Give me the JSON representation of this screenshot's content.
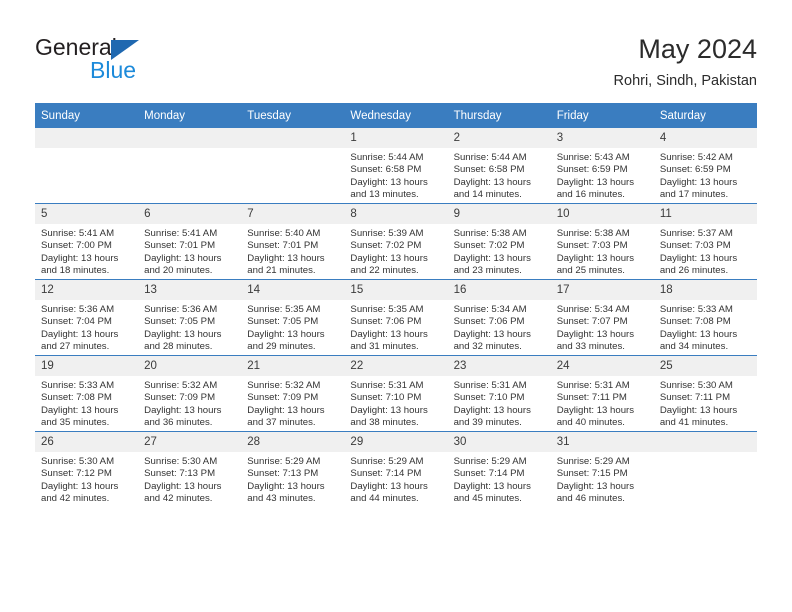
{
  "brand": {
    "name_top": "General",
    "name_bottom": "Blue",
    "accent_color": "#1c8ada",
    "triangle_color": "#1f68b0"
  },
  "header": {
    "title": "May 2024",
    "subtitle": "Rohri, Sindh, Pakistan"
  },
  "calendar": {
    "header_bg": "#3a7dc0",
    "daynum_bg": "#f0f0f0",
    "weekday_headers": [
      "Sunday",
      "Monday",
      "Tuesday",
      "Wednesday",
      "Thursday",
      "Friday",
      "Saturday"
    ],
    "weeks": [
      [
        {
          "day": "",
          "empty": true
        },
        {
          "day": "",
          "empty": true
        },
        {
          "day": "",
          "empty": true
        },
        {
          "day": "1",
          "sunrise": "Sunrise: 5:44 AM",
          "sunset": "Sunset: 6:58 PM",
          "daylight_1": "Daylight: 13 hours",
          "daylight_2": "and 13 minutes."
        },
        {
          "day": "2",
          "sunrise": "Sunrise: 5:44 AM",
          "sunset": "Sunset: 6:58 PM",
          "daylight_1": "Daylight: 13 hours",
          "daylight_2": "and 14 minutes."
        },
        {
          "day": "3",
          "sunrise": "Sunrise: 5:43 AM",
          "sunset": "Sunset: 6:59 PM",
          "daylight_1": "Daylight: 13 hours",
          "daylight_2": "and 16 minutes."
        },
        {
          "day": "4",
          "sunrise": "Sunrise: 5:42 AM",
          "sunset": "Sunset: 6:59 PM",
          "daylight_1": "Daylight: 13 hours",
          "daylight_2": "and 17 minutes."
        }
      ],
      [
        {
          "day": "5",
          "sunrise": "Sunrise: 5:41 AM",
          "sunset": "Sunset: 7:00 PM",
          "daylight_1": "Daylight: 13 hours",
          "daylight_2": "and 18 minutes."
        },
        {
          "day": "6",
          "sunrise": "Sunrise: 5:41 AM",
          "sunset": "Sunset: 7:01 PM",
          "daylight_1": "Daylight: 13 hours",
          "daylight_2": "and 20 minutes."
        },
        {
          "day": "7",
          "sunrise": "Sunrise: 5:40 AM",
          "sunset": "Sunset: 7:01 PM",
          "daylight_1": "Daylight: 13 hours",
          "daylight_2": "and 21 minutes."
        },
        {
          "day": "8",
          "sunrise": "Sunrise: 5:39 AM",
          "sunset": "Sunset: 7:02 PM",
          "daylight_1": "Daylight: 13 hours",
          "daylight_2": "and 22 minutes."
        },
        {
          "day": "9",
          "sunrise": "Sunrise: 5:38 AM",
          "sunset": "Sunset: 7:02 PM",
          "daylight_1": "Daylight: 13 hours",
          "daylight_2": "and 23 minutes."
        },
        {
          "day": "10",
          "sunrise": "Sunrise: 5:38 AM",
          "sunset": "Sunset: 7:03 PM",
          "daylight_1": "Daylight: 13 hours",
          "daylight_2": "and 25 minutes."
        },
        {
          "day": "11",
          "sunrise": "Sunrise: 5:37 AM",
          "sunset": "Sunset: 7:03 PM",
          "daylight_1": "Daylight: 13 hours",
          "daylight_2": "and 26 minutes."
        }
      ],
      [
        {
          "day": "12",
          "sunrise": "Sunrise: 5:36 AM",
          "sunset": "Sunset: 7:04 PM",
          "daylight_1": "Daylight: 13 hours",
          "daylight_2": "and 27 minutes."
        },
        {
          "day": "13",
          "sunrise": "Sunrise: 5:36 AM",
          "sunset": "Sunset: 7:05 PM",
          "daylight_1": "Daylight: 13 hours",
          "daylight_2": "and 28 minutes."
        },
        {
          "day": "14",
          "sunrise": "Sunrise: 5:35 AM",
          "sunset": "Sunset: 7:05 PM",
          "daylight_1": "Daylight: 13 hours",
          "daylight_2": "and 29 minutes."
        },
        {
          "day": "15",
          "sunrise": "Sunrise: 5:35 AM",
          "sunset": "Sunset: 7:06 PM",
          "daylight_1": "Daylight: 13 hours",
          "daylight_2": "and 31 minutes."
        },
        {
          "day": "16",
          "sunrise": "Sunrise: 5:34 AM",
          "sunset": "Sunset: 7:06 PM",
          "daylight_1": "Daylight: 13 hours",
          "daylight_2": "and 32 minutes."
        },
        {
          "day": "17",
          "sunrise": "Sunrise: 5:34 AM",
          "sunset": "Sunset: 7:07 PM",
          "daylight_1": "Daylight: 13 hours",
          "daylight_2": "and 33 minutes."
        },
        {
          "day": "18",
          "sunrise": "Sunrise: 5:33 AM",
          "sunset": "Sunset: 7:08 PM",
          "daylight_1": "Daylight: 13 hours",
          "daylight_2": "and 34 minutes."
        }
      ],
      [
        {
          "day": "19",
          "sunrise": "Sunrise: 5:33 AM",
          "sunset": "Sunset: 7:08 PM",
          "daylight_1": "Daylight: 13 hours",
          "daylight_2": "and 35 minutes."
        },
        {
          "day": "20",
          "sunrise": "Sunrise: 5:32 AM",
          "sunset": "Sunset: 7:09 PM",
          "daylight_1": "Daylight: 13 hours",
          "daylight_2": "and 36 minutes."
        },
        {
          "day": "21",
          "sunrise": "Sunrise: 5:32 AM",
          "sunset": "Sunset: 7:09 PM",
          "daylight_1": "Daylight: 13 hours",
          "daylight_2": "and 37 minutes."
        },
        {
          "day": "22",
          "sunrise": "Sunrise: 5:31 AM",
          "sunset": "Sunset: 7:10 PM",
          "daylight_1": "Daylight: 13 hours",
          "daylight_2": "and 38 minutes."
        },
        {
          "day": "23",
          "sunrise": "Sunrise: 5:31 AM",
          "sunset": "Sunset: 7:10 PM",
          "daylight_1": "Daylight: 13 hours",
          "daylight_2": "and 39 minutes."
        },
        {
          "day": "24",
          "sunrise": "Sunrise: 5:31 AM",
          "sunset": "Sunset: 7:11 PM",
          "daylight_1": "Daylight: 13 hours",
          "daylight_2": "and 40 minutes."
        },
        {
          "day": "25",
          "sunrise": "Sunrise: 5:30 AM",
          "sunset": "Sunset: 7:11 PM",
          "daylight_1": "Daylight: 13 hours",
          "daylight_2": "and 41 minutes."
        }
      ],
      [
        {
          "day": "26",
          "sunrise": "Sunrise: 5:30 AM",
          "sunset": "Sunset: 7:12 PM",
          "daylight_1": "Daylight: 13 hours",
          "daylight_2": "and 42 minutes."
        },
        {
          "day": "27",
          "sunrise": "Sunrise: 5:30 AM",
          "sunset": "Sunset: 7:13 PM",
          "daylight_1": "Daylight: 13 hours",
          "daylight_2": "and 42 minutes."
        },
        {
          "day": "28",
          "sunrise": "Sunrise: 5:29 AM",
          "sunset": "Sunset: 7:13 PM",
          "daylight_1": "Daylight: 13 hours",
          "daylight_2": "and 43 minutes."
        },
        {
          "day": "29",
          "sunrise": "Sunrise: 5:29 AM",
          "sunset": "Sunset: 7:14 PM",
          "daylight_1": "Daylight: 13 hours",
          "daylight_2": "and 44 minutes."
        },
        {
          "day": "30",
          "sunrise": "Sunrise: 5:29 AM",
          "sunset": "Sunset: 7:14 PM",
          "daylight_1": "Daylight: 13 hours",
          "daylight_2": "and 45 minutes."
        },
        {
          "day": "31",
          "sunrise": "Sunrise: 5:29 AM",
          "sunset": "Sunset: 7:15 PM",
          "daylight_1": "Daylight: 13 hours",
          "daylight_2": "and 46 minutes."
        },
        {
          "day": "",
          "empty": true
        }
      ]
    ]
  }
}
